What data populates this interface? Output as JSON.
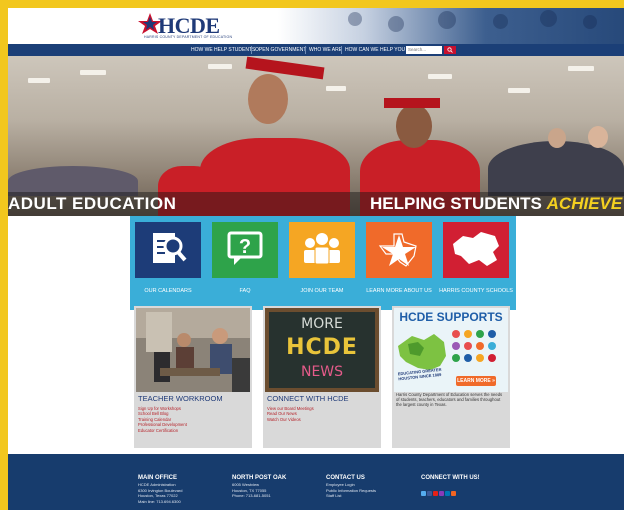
{
  "header": {
    "logo_text": "HCDE",
    "logo_subtitle": "HARRIS COUNTY DEPARTMENT OF EDUCATION"
  },
  "nav": {
    "items": [
      "HOW WE HELP STUDENTS",
      "OPEN GOVERNMENT",
      "WHO WE ARE",
      "HOW CAN WE HELP YOU"
    ],
    "search_placeholder": "Search..."
  },
  "hero": {
    "left_text": "ADULT EDUCATION",
    "right_text": "HELPING STUDENTS",
    "right_accent": "ACHIEVE"
  },
  "quick_links": [
    {
      "label": "OUR CALENDARS",
      "icon": "calendar-search-icon",
      "color": "#1d3c78"
    },
    {
      "label": "FAQ",
      "icon": "question-bubble-icon",
      "color": "#2ea34a"
    },
    {
      "label": "JOIN OUR TEAM",
      "icon": "team-icon",
      "color": "#f5a623"
    },
    {
      "label": "LEARN MORE ABOUT US",
      "icon": "texas-star-icon",
      "color": "#f06a2a"
    },
    {
      "label": "HARRIS COUNTY SCHOOLS",
      "icon": "county-map-icon",
      "color": "#d11f33"
    }
  ],
  "cards": {
    "workroom": {
      "title": "TEACHER WORKROOM",
      "links": [
        "Sign Up for Workshops",
        "School Bell Blog",
        "Training Calendar",
        "Professional Development",
        "Educator Certification"
      ]
    },
    "connect": {
      "title": "CONNECT WITH HCDE",
      "links": [
        "View our Board Meetings",
        "Read Our News",
        "Watch Our Videos"
      ],
      "chalk_lines": [
        "MORE",
        "HCDE",
        "NEWS"
      ]
    },
    "supports": {
      "heading": "HCDE SUPPORTS",
      "banner": "EDUCATING GREATER HOUSTON SINCE 1889",
      "button": "LEARN MORE »",
      "description": "Harris County Department of Education serves the needs of students, teachers, educators and families throughout the largest county in Texas."
    }
  },
  "footer": {
    "main_office": {
      "heading": "MAIN OFFICE",
      "lines": [
        "HCDE Administration",
        "6300 Irvington Boulevard",
        "Houston, Texas 77022",
        "Main line: 713.694.6300"
      ]
    },
    "north_post_oak": {
      "heading": "NORTH POST OAK",
      "lines": [
        "6005 Westview",
        "Houston, TX 77055",
        "Phone: 713-681-5051"
      ]
    },
    "contact_us": {
      "heading": "CONTACT US",
      "lines": [
        "Employee Login",
        "Public Information Requests",
        "Staff List"
      ]
    },
    "connect": {
      "heading": "CONNECT WITH US!",
      "icons": [
        "twitter-icon",
        "facebook-icon",
        "youtube-icon",
        "instagram-icon",
        "linkedin-icon",
        "rss-icon"
      ]
    }
  }
}
